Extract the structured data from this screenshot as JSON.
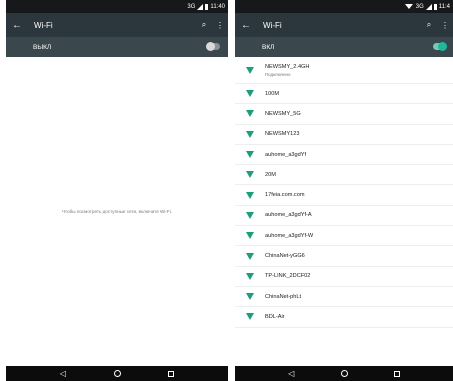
{
  "left": {
    "status": {
      "network": "3G",
      "time": "11:40"
    },
    "appbar": {
      "title": "Wi-Fi",
      "back_icon": "←",
      "search_icon": "⌕",
      "menu_icon": "⋮"
    },
    "toggle": {
      "label": "ВЫКЛ",
      "state": "off"
    },
    "empty_message": "Чтобы посмотреть доступные сети, включите Wi-Fi."
  },
  "right": {
    "status": {
      "network": "3G",
      "time": "11:4"
    },
    "appbar": {
      "title": "Wi-Fi",
      "back_icon": "←",
      "search_icon": "⌕",
      "menu_icon": "⋮"
    },
    "toggle": {
      "label": "ВКЛ",
      "state": "on"
    },
    "networks": [
      {
        "name": "NEWSMY_2.4GH",
        "status": "Подключено"
      },
      {
        "name": "100M"
      },
      {
        "name": "NEWSMY_5G"
      },
      {
        "name": "NEWSMY123"
      },
      {
        "name": "auhome_a3gdYf"
      },
      {
        "name": "20M"
      },
      {
        "name": "17feia.com.com"
      },
      {
        "name": "auhome_a3gdYf-A"
      },
      {
        "name": "auhome_a3gdYf-W"
      },
      {
        "name": "ChinaNet-yGG6"
      },
      {
        "name": "TP-LINK_2DCF02"
      },
      {
        "name": "ChinaNet-phLt"
      },
      {
        "name": "BDL-Air"
      }
    ]
  },
  "navbar": {
    "back": "◁"
  },
  "colors": {
    "appbar": "#2b373d",
    "togglebar": "#3a474c",
    "accent": "#1d9c7e"
  }
}
